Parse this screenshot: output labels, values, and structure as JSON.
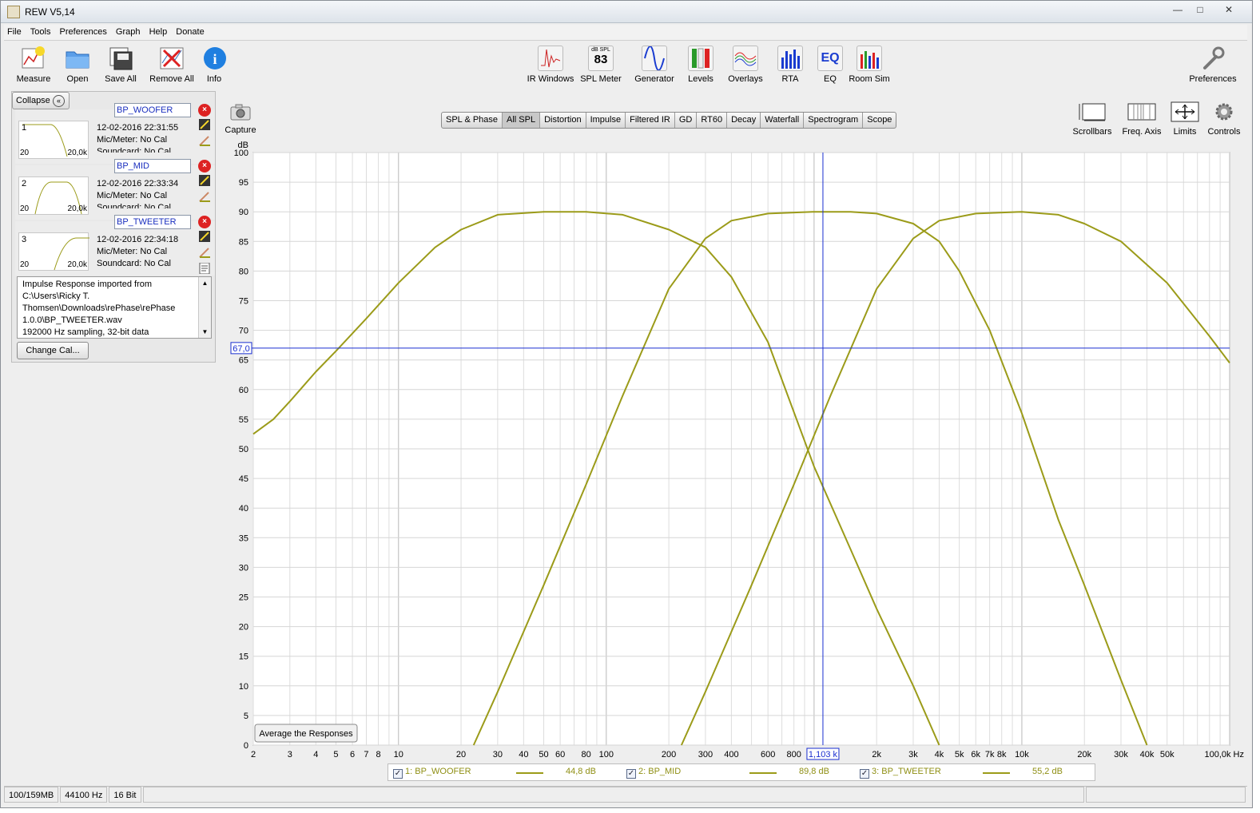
{
  "window": {
    "title": "REW V5,14"
  },
  "menu": [
    "File",
    "Tools",
    "Preferences",
    "Graph",
    "Help",
    "Donate"
  ],
  "toolbar": {
    "left": [
      {
        "label": "Measure",
        "icon": "measure-icon"
      },
      {
        "label": "Open",
        "icon": "folder-icon"
      },
      {
        "label": "Save All",
        "icon": "save-all-icon"
      },
      {
        "label": "Remove All",
        "icon": "remove-all-icon"
      },
      {
        "label": "Info",
        "icon": "info-icon"
      }
    ],
    "center": [
      {
        "label": "IR Windows",
        "icon": "ir-windows-icon"
      },
      {
        "label": "SPL Meter",
        "icon": "spl-meter-icon",
        "badge_top": "dB SPL",
        "badge_value": "83"
      },
      {
        "label": "Generator",
        "icon": "generator-icon"
      },
      {
        "label": "Levels",
        "icon": "levels-icon"
      },
      {
        "label": "Overlays",
        "icon": "overlays-icon"
      },
      {
        "label": "RTA",
        "icon": "rta-icon"
      },
      {
        "label": "EQ",
        "icon": "eq-icon",
        "badge_value": "EQ"
      },
      {
        "label": "Room Sim",
        "icon": "room-sim-icon"
      }
    ],
    "right": {
      "label": "Preferences",
      "icon": "wrench-icon"
    }
  },
  "graph_tools": {
    "capture": "Capture",
    "right": [
      {
        "label": "Scrollbars",
        "icon": "scrollbars-icon"
      },
      {
        "label": "Freq. Axis",
        "icon": "freq-axis-icon"
      },
      {
        "label": "Limits",
        "icon": "limits-icon"
      },
      {
        "label": "Controls",
        "icon": "controls-icon"
      }
    ]
  },
  "panel": {
    "collapse_label": "Collapse",
    "measurements": [
      {
        "index": "1",
        "name": "BP_WOOFER",
        "date": "12-02-2016 22:31:55",
        "mic": "Mic/Meter: No Cal",
        "soundcard": "Soundcard: No Cal",
        "lo": "20",
        "hi": "20,0k"
      },
      {
        "index": "2",
        "name": "BP_MID",
        "date": "12-02-2016 22:33:34",
        "mic": "Mic/Meter: No Cal",
        "soundcard": "Soundcard: No Cal",
        "lo": "20",
        "hi": "20,0k"
      },
      {
        "index": "3",
        "name": "BP_TWEETER",
        "date": "12-02-2016 22:34:18",
        "mic": "Mic/Meter: No Cal",
        "soundcard": "Soundcard: No Cal",
        "lo": "20",
        "hi": "20,0k"
      }
    ],
    "notes": [
      "Impulse Response imported from",
      "C:\\Users\\Ricky T.",
      "Thomsen\\Downloads\\rePhase\\rePhase",
      "1.0.0\\BP_TWEETER.wav",
      "192000 Hz sampling, 32-bit data"
    ],
    "change_cal_label": "Change Cal..."
  },
  "tabs": [
    {
      "label": "SPL & Phase",
      "active": false
    },
    {
      "label": "All SPL",
      "active": true
    },
    {
      "label": "Distortion",
      "active": false
    },
    {
      "label": "Impulse",
      "active": false
    },
    {
      "label": "Filtered IR",
      "active": false
    },
    {
      "label": "GD",
      "active": false
    },
    {
      "label": "RT60",
      "active": false
    },
    {
      "label": "Decay",
      "active": false
    },
    {
      "label": "Waterfall",
      "active": false
    },
    {
      "label": "Spectrogram",
      "active": false
    },
    {
      "label": "Scope",
      "active": false
    }
  ],
  "chart_data": {
    "type": "line",
    "ylabel": "dB",
    "ylim": [
      0,
      100
    ],
    "xlim": [
      2,
      100000
    ],
    "xscale": "log",
    "y_ticks": [
      "0",
      "5",
      "10",
      "15",
      "20",
      "25",
      "30",
      "35",
      "40",
      "45",
      "50",
      "55",
      "60",
      "65",
      "70",
      "75",
      "80",
      "85",
      "90",
      "95",
      "100"
    ],
    "x_ticks": [
      {
        "v": 2,
        "t": "2"
      },
      {
        "v": 3,
        "t": "3"
      },
      {
        "v": 4,
        "t": "4"
      },
      {
        "v": 5,
        "t": "5"
      },
      {
        "v": 6,
        "t": "6"
      },
      {
        "v": 7,
        "t": "7"
      },
      {
        "v": 8,
        "t": "8"
      },
      {
        "v": 10,
        "t": "10"
      },
      {
        "v": 20,
        "t": "20"
      },
      {
        "v": 30,
        "t": "30"
      },
      {
        "v": 40,
        "t": "40"
      },
      {
        "v": 50,
        "t": "50"
      },
      {
        "v": 60,
        "t": "60"
      },
      {
        "v": 80,
        "t": "80"
      },
      {
        "v": 100,
        "t": "100"
      },
      {
        "v": 200,
        "t": "200"
      },
      {
        "v": 300,
        "t": "300"
      },
      {
        "v": 400,
        "t": "400"
      },
      {
        "v": 600,
        "t": "600"
      },
      {
        "v": 800,
        "t": "800"
      },
      {
        "v": 2000,
        "t": "2k"
      },
      {
        "v": 3000,
        "t": "3k"
      },
      {
        "v": 4000,
        "t": "4k"
      },
      {
        "v": 5000,
        "t": "5k"
      },
      {
        "v": 6000,
        "t": "6k"
      },
      {
        "v": 7000,
        "t": "7k"
      },
      {
        "v": 8000,
        "t": "8k"
      },
      {
        "v": 10000,
        "t": "10k"
      },
      {
        "v": 20000,
        "t": "20k"
      },
      {
        "v": 30000,
        "t": "30k"
      },
      {
        "v": 40000,
        "t": "40k"
      },
      {
        "v": 50000,
        "t": "50k"
      },
      {
        "v": 100000,
        "t": "100,0k Hz"
      }
    ],
    "cursor": {
      "x": 1103,
      "x_label": "1,103 k",
      "y": 67.0,
      "y_label": "67,0"
    },
    "button_label": "Average the Responses",
    "series": [
      {
        "name": "1: BP_WOOFER",
        "value_label": "44,8 dB",
        "x": [
          2,
          2.5,
          3,
          4,
          5,
          7,
          10,
          15,
          20,
          30,
          50,
          80,
          120,
          200,
          300,
          400,
          600,
          1000,
          1500,
          2000,
          3000,
          4000
        ],
        "y": [
          52.5,
          55,
          58,
          63,
          66.5,
          72,
          78,
          84,
          87,
          89.5,
          90,
          90,
          89.5,
          87,
          84,
          79,
          68,
          47,
          33,
          23,
          10,
          0
        ]
      },
      {
        "name": "2: BP_MID",
        "value_label": "89,8 dB",
        "x": [
          23,
          30,
          50,
          80,
          120,
          200,
          300,
          400,
          600,
          1000,
          1500,
          2000,
          3000,
          4000,
          5000,
          7000,
          10000,
          15000,
          20000,
          30000,
          40000
        ],
        "y": [
          0,
          9,
          27,
          44,
          59,
          77,
          85.5,
          88.5,
          89.7,
          90,
          90,
          89.7,
          88,
          85,
          80,
          70,
          56,
          38,
          27,
          11,
          0
        ]
      },
      {
        "name": "3: BP_TWEETER",
        "value_label": "55,2 dB",
        "x": [
          230,
          300,
          500,
          800,
          1200,
          2000,
          3000,
          4000,
          6000,
          10000,
          15000,
          20000,
          30000,
          50000,
          80000,
          100000
        ],
        "y": [
          0,
          9,
          27,
          44,
          59,
          77,
          85.5,
          88.5,
          89.7,
          90,
          89.5,
          88,
          85,
          78,
          69,
          64.5
        ]
      }
    ],
    "series_color": "#9b9b19",
    "cursor_color": "#1a2fd0"
  },
  "status": {
    "memory": "100/159MB",
    "rate": "44100 Hz",
    "bits": "16 Bit"
  }
}
